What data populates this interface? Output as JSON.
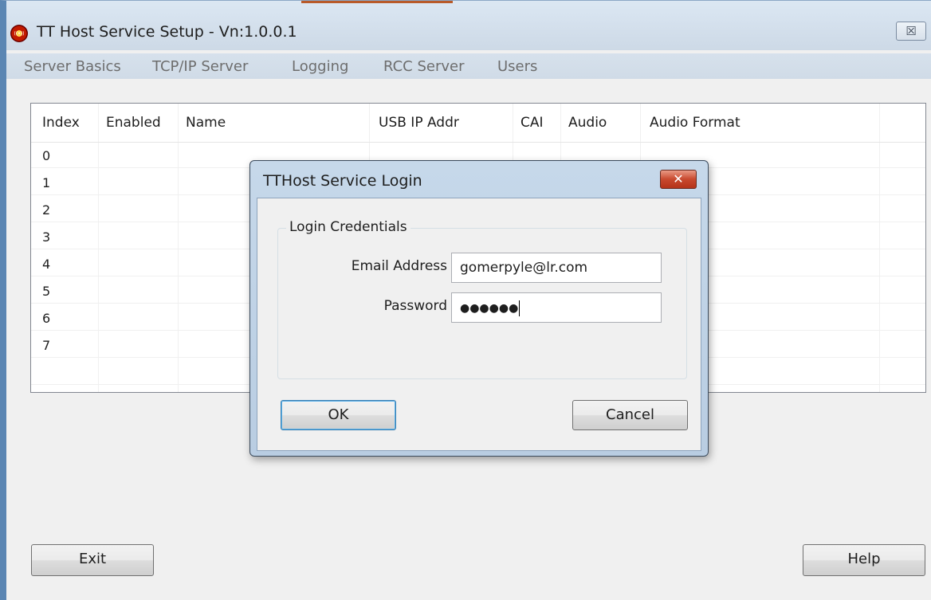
{
  "window": {
    "title": "TT Host Service Setup - Vn:1.0.0.1",
    "close_glyph": "☒",
    "app_icon_glyph": "((•))"
  },
  "menu": {
    "items": [
      "Server Basics",
      "TCP/IP Server",
      "Logging",
      "RCC Server",
      "Users"
    ]
  },
  "table": {
    "columns": [
      "Index",
      "Enabled",
      "Name",
      "USB IP Addr",
      "CAI",
      "Audio",
      "Audio Format"
    ],
    "rows": [
      "0",
      "1",
      "2",
      "3",
      "4",
      "5",
      "6",
      "7"
    ]
  },
  "buttons": {
    "exit": "Exit",
    "help": "Help"
  },
  "dialog": {
    "title": "TTHost Service Login",
    "close_glyph": "✕",
    "group_label": "Login Credentials",
    "email_label": "Email Address",
    "email_value": "gomerpyle@lr.com",
    "password_label": "Password",
    "password_masked": "●●●●●●",
    "ok": "OK",
    "cancel": "Cancel"
  },
  "colors": {
    "dialog_close": "#c8492e",
    "title_accent": "#b85a2a",
    "window_border": "#5b86b3"
  }
}
